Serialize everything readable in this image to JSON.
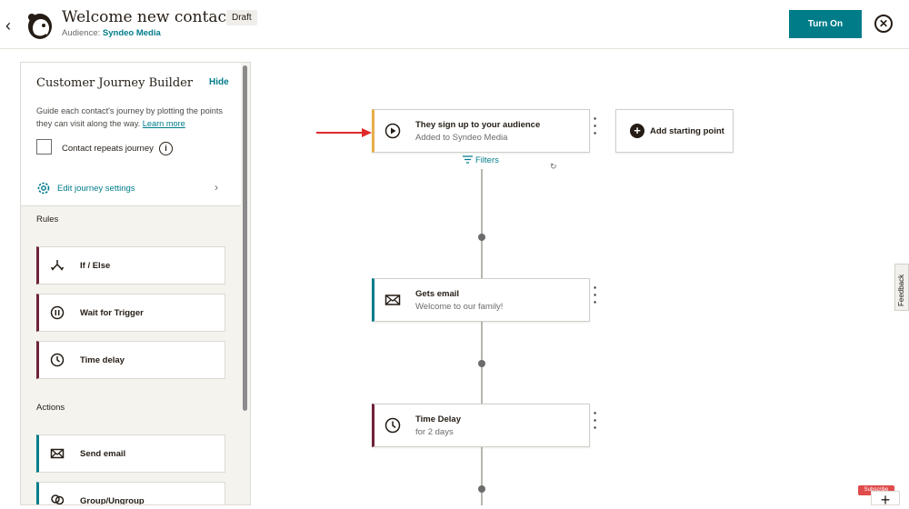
{
  "header": {
    "title": "Welcome new contacts",
    "status_badge": "Draft",
    "audience_label": "Audience:",
    "audience_name": "Syndeo Media",
    "turn_on_label": "Turn On",
    "back_icon": "chevron-left-icon",
    "close_icon": "close-circle-icon"
  },
  "panel": {
    "title": "Customer Journey Builder",
    "hide_label": "Hide",
    "description": "Guide each contact's journey by plotting the points they can visit along the way.",
    "learn_more": "Learn more",
    "repeat_label": "Contact repeats journey",
    "settings_label": "Edit journey settings",
    "rules_heading": "Rules",
    "rules": [
      {
        "label": "If / Else",
        "icon": "branch-icon"
      },
      {
        "label": "Wait for Trigger",
        "icon": "pause-icon"
      },
      {
        "label": "Time delay",
        "icon": "clock-icon"
      }
    ],
    "actions_heading": "Actions",
    "actions": [
      {
        "label": "Send email",
        "icon": "envelope-icon"
      },
      {
        "label": "Group/Ungroup",
        "icon": "group-icon"
      }
    ]
  },
  "canvas": {
    "trigger": {
      "title": "They sign up to your audience",
      "subtitle": "Added to Syndeo Media"
    },
    "add_starting_point": "Add starting point",
    "filters_label": "Filters",
    "steps": [
      {
        "title": "Gets email",
        "subtitle": "Welcome to our family!",
        "icon": "envelope-icon"
      },
      {
        "title": "Time Delay",
        "subtitle": "for 2 days",
        "icon": "clock-icon"
      }
    ]
  },
  "feedback_label": "Feedback",
  "subscribe_label": "Subscribe",
  "colors": {
    "accent": "#007c89",
    "rule_border": "#6e2338",
    "trigger_border": "#e7b04a",
    "arrow": "#e02a2a"
  }
}
